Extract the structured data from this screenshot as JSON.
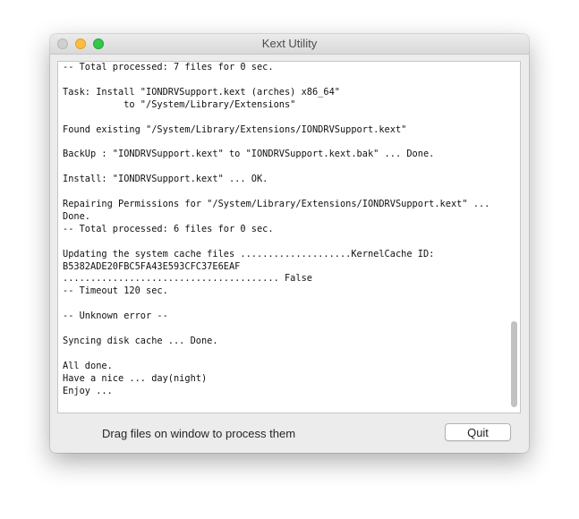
{
  "window": {
    "title": "Kext Utility"
  },
  "log": {
    "lines": [
      "-- Total processed: 7 files for 0 sec.",
      "",
      "Task: Install \"IONDRVSupport.kext (arches) x86_64\"",
      "           to \"/System/Library/Extensions\"",
      "",
      "Found existing \"/System/Library/Extensions/IONDRVSupport.kext\"",
      "",
      "BackUp : \"IONDRVSupport.kext\" to \"IONDRVSupport.kext.bak\" ... Done.",
      "",
      "Install: \"IONDRVSupport.kext\" ... OK.",
      "",
      "Repairing Permissions for \"/System/Library/Extensions/IONDRVSupport.kext\" ...",
      "Done.",
      "-- Total processed: 6 files for 0 sec.",
      "",
      "Updating the system cache files ....................KernelCache ID:",
      "B5382ADE20FBC5FA43E593CFC37E6EAF",
      "....................................... False",
      "-- Timeout 120 sec.",
      "",
      "-- Unknown error --",
      "",
      "Syncing disk cache ... Done.",
      "",
      "All done.",
      "Have a nice ... day(night)",
      "Enjoy ..."
    ]
  },
  "footer": {
    "hint": "Drag files on window to process them",
    "quit_label": "Quit"
  },
  "colors": {
    "close_light": "#d0d0d0",
    "minimize_light": "#fdbd41",
    "zoom_light": "#34c84a"
  }
}
